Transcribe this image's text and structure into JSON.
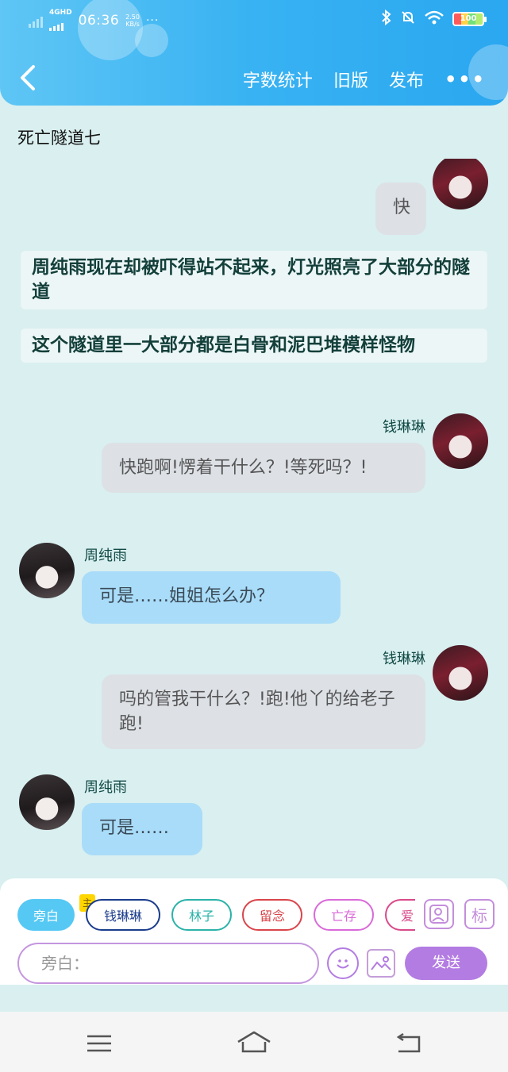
{
  "status_bar": {
    "network": "4GHD",
    "time": "06:36",
    "speed_value": "2.50",
    "speed_unit": "KB/s",
    "more": "···",
    "battery": "100"
  },
  "toolbar": {
    "word_count": "字数统计",
    "old_version": "旧版",
    "publish": "发布",
    "more": "•••"
  },
  "chapter_title": "死亡隧道七",
  "messages": [
    {
      "speaker": "钱琳琳",
      "text": "快",
      "side": "right"
    },
    {
      "narration": "周纯雨现在却被吓得站不起来，灯光照亮了大部分的隧道"
    },
    {
      "narration": "这个隧道里一大部分都是白骨和泥巴堆模样怪物"
    },
    {
      "speaker": "钱琳琳",
      "text": "快跑啊!愣着干什么？!等死吗？!",
      "side": "right"
    },
    {
      "speaker": "周纯雨",
      "text": "可是……姐姐怎么办？",
      "side": "left"
    },
    {
      "speaker": "钱琳琳",
      "text": "吗的管我干什么？!跑!他丫的给老子跑!",
      "side": "right"
    },
    {
      "speaker": "周纯雨",
      "text": "可是……",
      "side": "left"
    }
  ],
  "roles": {
    "narrator": "旁白",
    "main_badge": "主",
    "chips": [
      {
        "label": "钱琳琳",
        "color": "#1a3c8c"
      },
      {
        "label": "林子",
        "color": "#2bb3a9"
      },
      {
        "label": "留念",
        "color": "#d9454b"
      },
      {
        "label": "亡存",
        "color": "#d96ad9"
      },
      {
        "label": "爱",
        "color": "#d94a8a"
      }
    ],
    "tag_label": "标"
  },
  "input": {
    "placeholder": "旁白：",
    "send": "发送"
  }
}
